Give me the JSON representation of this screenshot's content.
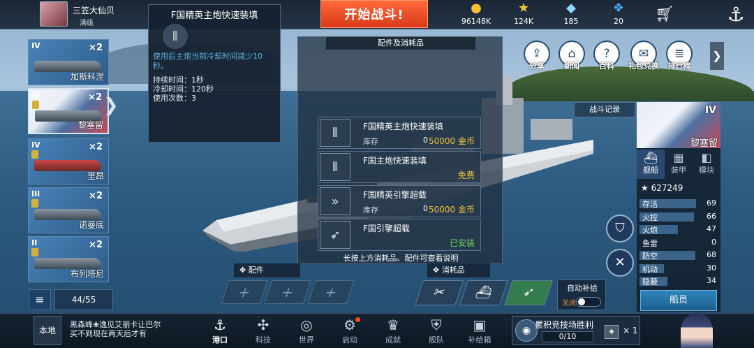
{
  "player": {
    "name": "三笠大仙贝",
    "level": "满级"
  },
  "start_label": "开始战斗!",
  "resources": [
    {
      "icon": "gold-coin-icon",
      "glyph": "●",
      "color": "#f5c033",
      "value": "96148K"
    },
    {
      "icon": "star-icon",
      "glyph": "★",
      "color": "#f6c640",
      "value": "124K"
    },
    {
      "icon": "diamond-icon",
      "glyph": "◆",
      "color": "#8fd6ff",
      "value": "185"
    },
    {
      "icon": "crystal-icon",
      "glyph": "❖",
      "color": "#4aa8f0",
      "value": "20"
    }
  ],
  "tooltip": {
    "title": "F国精英主炮快速装填",
    "desc": "使用后主炮当前冷却时间减少10秒。",
    "duration": "持续时间：1秒",
    "cooldown": "冷却时间：120秒",
    "uses": "使用次数：3"
  },
  "ships": [
    {
      "tier": "IV",
      "count": "×2",
      "name": "加斯科涅"
    },
    {
      "tier": "IV",
      "count": "×2",
      "name": "黎塞留"
    },
    {
      "tier": "IV",
      "count": "×2",
      "name": "里昂"
    },
    {
      "tier": "III",
      "count": "×2",
      "name": "诺曼底"
    },
    {
      "tier": "II",
      "count": "×2",
      "name": "布列塔尼"
    }
  ],
  "list_count": "44/55",
  "panel": {
    "title": "配件及消耗品",
    "items": [
      {
        "name": "F国精英主炮快速装填",
        "stock_label": "库存",
        "qty": "0",
        "price": "50000 金币"
      },
      {
        "name": "F国主炮快速装填",
        "status": "免费"
      },
      {
        "name": "F国精英引擎超载",
        "stock_label": "库存",
        "qty": "0",
        "price": "50000 金币"
      },
      {
        "name": "F国引擎超载",
        "status": "已安装"
      }
    ],
    "hint": "长按上方消耗品、配件可查看说明"
  },
  "top_icons": [
    {
      "label": "分享",
      "icon": "share-icon",
      "glyph": "⇪"
    },
    {
      "label": "新闻",
      "icon": "news-icon",
      "glyph": "⌂"
    },
    {
      "label": "百科",
      "icon": "wiki-icon",
      "glyph": "?"
    },
    {
      "label": "礼包兑换",
      "icon": "gift-icon",
      "glyph": "✉"
    },
    {
      "label": "排行榜",
      "icon": "ranking-icon",
      "glyph": "≣"
    }
  ],
  "battle_record": "战斗记录",
  "ship_info": {
    "tier": "IV",
    "name": "黎塞留",
    "tabs": [
      {
        "label": "舰船",
        "glyph": "⛴"
      },
      {
        "label": "装甲",
        "glyph": "▦"
      },
      {
        "label": "模块",
        "glyph": "◧"
      }
    ],
    "score": "627249",
    "stats": [
      {
        "label": "存活",
        "value": "69",
        "fill": 0.69
      },
      {
        "label": "火控",
        "value": "66",
        "fill": 0.66
      },
      {
        "label": "火炮",
        "value": "47",
        "fill": 0.47
      },
      {
        "label": "鱼雷",
        "value": "0",
        "fill": 0.0
      },
      {
        "label": "防空",
        "value": "68",
        "fill": 0.68
      },
      {
        "label": "机动",
        "value": "30",
        "fill": 0.3
      },
      {
        "label": "隐蔽",
        "value": "34",
        "fill": 0.34
      }
    ],
    "crew_label": "船员"
  },
  "config": {
    "accessories_label": "配件",
    "consumables_label": "消耗品",
    "auto_supply": "自动补给",
    "auto_off": "关闭"
  },
  "chat": {
    "local": "本地",
    "message": "黑森峰❀逸见艾丽卡让巴尔买不到现在两天后才有"
  },
  "nav": [
    {
      "label": "港口",
      "icon": "port-icon",
      "glyph": "⚓",
      "active": true
    },
    {
      "label": "科技",
      "icon": "tech-icon",
      "glyph": "✣"
    },
    {
      "label": "世界",
      "icon": "world-icon",
      "glyph": "◎"
    },
    {
      "label": "启动",
      "icon": "launch-icon",
      "glyph": "⚙",
      "dot": true
    },
    {
      "label": "成就",
      "icon": "achievement-icon",
      "glyph": "♛"
    },
    {
      "label": "舰队",
      "icon": "fleet-icon",
      "glyph": "⛨"
    },
    {
      "label": "补给箱",
      "icon": "supply-box-icon",
      "glyph": "▣"
    }
  ],
  "arena": {
    "title": "累积竞技场胜利",
    "progress": "0/10",
    "count": "× 1"
  }
}
